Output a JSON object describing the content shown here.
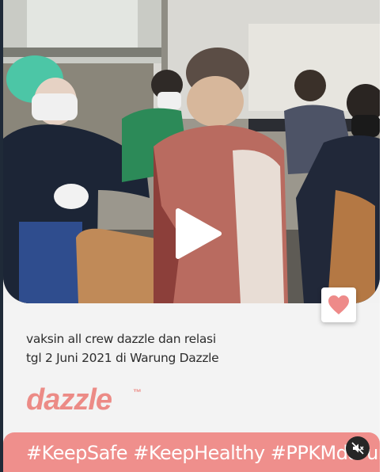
{
  "video": {
    "play_icon": "play-icon"
  },
  "like": {
    "icon": "heart-icon",
    "color": "#ee8a89"
  },
  "post": {
    "caption_lines": [
      "vaksin all crew dazzle dan relasi",
      "tgl 2 Juni 2021 di Warung Dazzle"
    ],
    "brand": "dazzle",
    "brand_mark": "™",
    "hashtags": "#KeepSafe #KeepHealthy #PPKMdarurat"
  },
  "controls": {
    "mute_icon": "speaker-muted-icon"
  },
  "colors": {
    "accent": "#ef8f8c",
    "brand": "#ec8b86",
    "card_background": "#f3f3f3"
  }
}
